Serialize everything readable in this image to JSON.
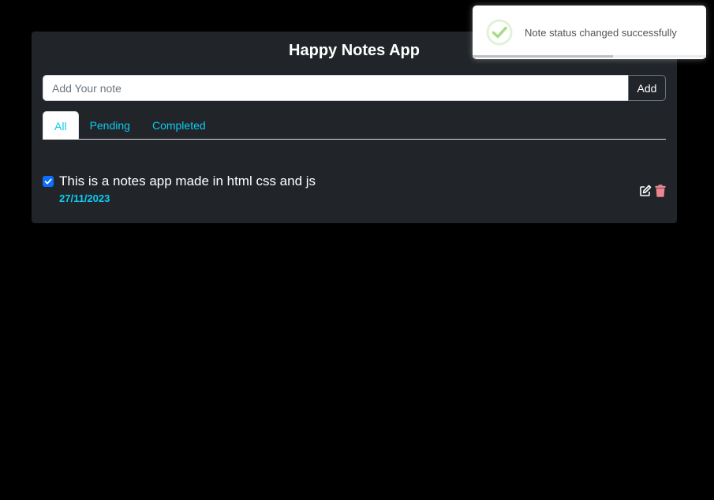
{
  "app": {
    "title": "Happy Notes App"
  },
  "input": {
    "placeholder": "Add Your note",
    "value": "",
    "add_label": "Add"
  },
  "tabs": [
    {
      "label": "All",
      "active": true
    },
    {
      "label": "Pending",
      "active": false
    },
    {
      "label": "Completed",
      "active": false
    }
  ],
  "notes": [
    {
      "text": "This is a notes app made in html css and js",
      "date": "27/11/2023",
      "completed": true
    }
  ],
  "toast": {
    "message": "Note status changed successfully",
    "icon": "success-check-icon",
    "progress": 0.6
  },
  "colors": {
    "background": "#000000",
    "card": "#212529",
    "accent": "#0dcaf0",
    "checkbox": "#0d6efd",
    "delete": "#ea868f",
    "success": "#a5dc86"
  }
}
